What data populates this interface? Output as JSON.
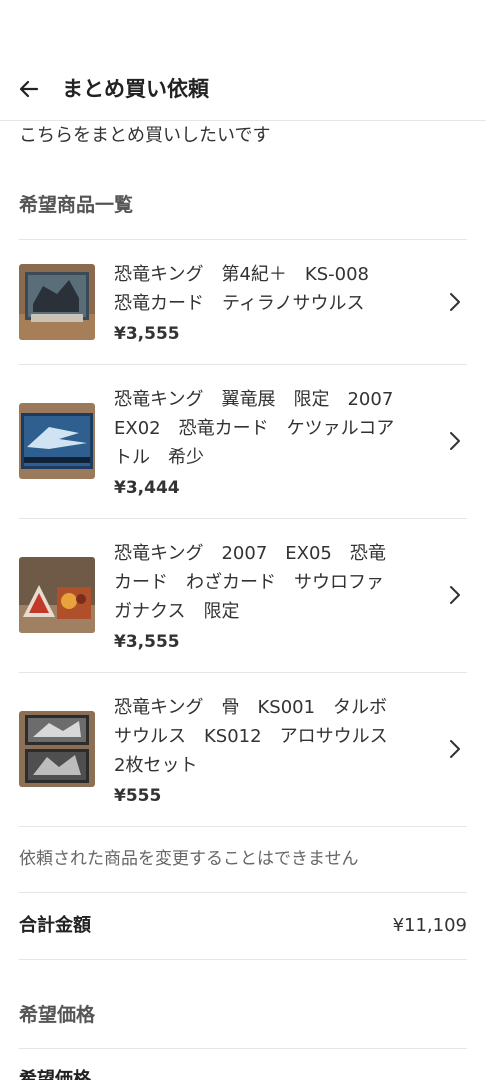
{
  "header": {
    "title": "まとめ買い依頼",
    "back_icon": "arrow-left-icon"
  },
  "message": "こちらをまとめ買いしたいです",
  "section_items_title": "希望商品一覧",
  "items": [
    {
      "name_lines": [
        "恐竜キング　第4紀＋　KS-008",
        "恐竜カード　ティラノサウルス"
      ],
      "price": "¥3,555"
    },
    {
      "name_lines": [
        "恐竜キング　翼竜展　限定　2007",
        "EX02　恐竜カード　ケツァルコア",
        "トル　希少"
      ],
      "price": "¥3,444"
    },
    {
      "name_lines": [
        "恐竜キング　2007　EX05　恐竜",
        "カード　わざカード　サウロファ",
        "ガナクス　限定"
      ],
      "price": "¥3,555"
    },
    {
      "name_lines": [
        "恐竜キング　骨　KS001　タルボ",
        "サウルス　KS012　アロサウルス",
        "2枚セット"
      ],
      "price": "¥555"
    }
  ],
  "note": "依頼された商品を変更することはできません",
  "total": {
    "label": "合計金額",
    "value": "¥11,109"
  },
  "section_price_title": "希望価格",
  "desired_price_label": "希望価格"
}
